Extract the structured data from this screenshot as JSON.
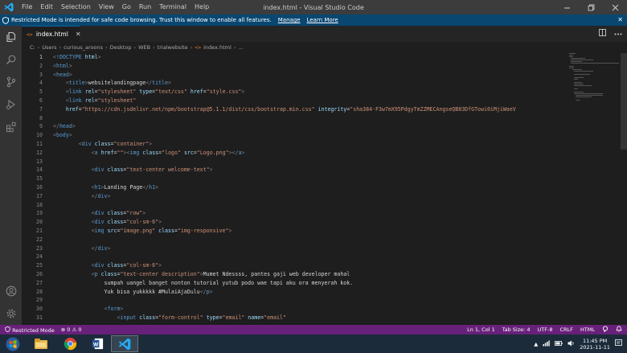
{
  "titlebar": {
    "menu": [
      "File",
      "Edit",
      "Selection",
      "View",
      "Go",
      "Run",
      "Terminal",
      "Help"
    ],
    "title": "index.html - Visual Studio Code",
    "controls": {
      "minimize": "🗕",
      "restore": "🗗",
      "close": "✕"
    }
  },
  "banner": {
    "message": "Restricted Mode is intended for safe code browsing. Trust this window to enable all features.",
    "manage": "Manage",
    "learn_more": "Learn More",
    "close": "✕"
  },
  "tab": {
    "icon": "<>",
    "label": "index.html",
    "close": "✕"
  },
  "breadcrumb": [
    "C:",
    "Users",
    "curious_aroons",
    "Desktop",
    "WEB",
    "trialwebsite",
    "index.html",
    "..."
  ],
  "code": {
    "lines": [
      [
        [
          "#808080",
          "<"
        ],
        [
          "#569cd6",
          "!DOCTYPE"
        ],
        [
          "#d4d4d4",
          " "
        ],
        [
          "#9cdcfe",
          "html"
        ],
        [
          "#808080",
          ">"
        ]
      ],
      [
        [
          "#808080",
          "<"
        ],
        [
          "#569cd6",
          "html"
        ],
        [
          "#808080",
          ">"
        ]
      ],
      [
        [
          "#808080",
          "<"
        ],
        [
          "#569cd6",
          "head"
        ],
        [
          "#808080",
          ">"
        ]
      ],
      [
        [
          "#d4d4d4",
          "    "
        ],
        [
          "#808080",
          "<"
        ],
        [
          "#569cd6",
          "title"
        ],
        [
          "#808080",
          ">"
        ],
        [
          "#d4d4d4",
          "websitelandingpage"
        ],
        [
          "#808080",
          "</"
        ],
        [
          "#569cd6",
          "title"
        ],
        [
          "#808080",
          ">"
        ]
      ],
      [
        [
          "#d4d4d4",
          "    "
        ],
        [
          "#808080",
          "<"
        ],
        [
          "#569cd6",
          "link"
        ],
        [
          "#d4d4d4",
          " "
        ],
        [
          "#9cdcfe",
          "rel"
        ],
        [
          "#d4d4d4",
          "="
        ],
        [
          "#ce9178",
          "\"stylesheet\""
        ],
        [
          "#d4d4d4",
          " "
        ],
        [
          "#9cdcfe",
          "type"
        ],
        [
          "#d4d4d4",
          "="
        ],
        [
          "#ce9178",
          "\"text/css\""
        ],
        [
          "#d4d4d4",
          " "
        ],
        [
          "#9cdcfe",
          "href"
        ],
        [
          "#d4d4d4",
          "="
        ],
        [
          "#ce9178",
          "\"style.css\""
        ],
        [
          "#808080",
          ">"
        ]
      ],
      [
        [
          "#d4d4d4",
          "    "
        ],
        [
          "#808080",
          "<"
        ],
        [
          "#569cd6",
          "link"
        ],
        [
          "#d4d4d4",
          " "
        ],
        [
          "#9cdcfe",
          "rel"
        ],
        [
          "#d4d4d4",
          "="
        ],
        [
          "#ce9178",
          "\"stylesheet\""
        ]
      ],
      [
        [
          "#d4d4d4",
          "    "
        ],
        [
          "#9cdcfe",
          "href"
        ],
        [
          "#d4d4d4",
          "="
        ],
        [
          "#ce9178",
          "\"https://cdn.jsdelivr.net/npm/bootstrap@5.1.1/dist/css/bootstrap.min.css\""
        ],
        [
          "#d4d4d4",
          " "
        ],
        [
          "#9cdcfe",
          "integrity"
        ],
        [
          "#d4d4d4",
          "="
        ],
        [
          "#ce9178",
          "\"sha384-F3w7mX95PdgyTmZZMECAngseQB83DfGTowi0iMjiWaeV"
        ]
      ],
      [
        [
          "#d4d4d4",
          ""
        ]
      ],
      [
        [
          "#808080",
          "</"
        ],
        [
          "#569cd6",
          "head"
        ],
        [
          "#808080",
          ">"
        ]
      ],
      [
        [
          "#808080",
          "<"
        ],
        [
          "#569cd6",
          "body"
        ],
        [
          "#808080",
          ">"
        ]
      ],
      [
        [
          "#d4d4d4",
          "        "
        ],
        [
          "#808080",
          "<"
        ],
        [
          "#569cd6",
          "div"
        ],
        [
          "#d4d4d4",
          " "
        ],
        [
          "#9cdcfe",
          "class"
        ],
        [
          "#d4d4d4",
          "="
        ],
        [
          "#ce9178",
          "\"container\""
        ],
        [
          "#808080",
          ">"
        ]
      ],
      [
        [
          "#d4d4d4",
          "            "
        ],
        [
          "#808080",
          "<"
        ],
        [
          "#569cd6",
          "a"
        ],
        [
          "#d4d4d4",
          " "
        ],
        [
          "#9cdcfe",
          "href"
        ],
        [
          "#d4d4d4",
          "="
        ],
        [
          "#ce9178",
          "\"\""
        ],
        [
          "#808080",
          "><"
        ],
        [
          "#569cd6",
          "img"
        ],
        [
          "#d4d4d4",
          " "
        ],
        [
          "#9cdcfe",
          "class"
        ],
        [
          "#d4d4d4",
          "="
        ],
        [
          "#ce9178",
          "\"logo\""
        ],
        [
          "#d4d4d4",
          " "
        ],
        [
          "#9cdcfe",
          "src"
        ],
        [
          "#d4d4d4",
          "="
        ],
        [
          "#ce9178",
          "\"Logo.png\""
        ],
        [
          "#808080",
          "></"
        ],
        [
          "#569cd6",
          "a"
        ],
        [
          "#808080",
          ">"
        ]
      ],
      [
        [
          "#d4d4d4",
          ""
        ]
      ],
      [
        [
          "#d4d4d4",
          "            "
        ],
        [
          "#808080",
          "<"
        ],
        [
          "#569cd6",
          "div"
        ],
        [
          "#d4d4d4",
          " "
        ],
        [
          "#9cdcfe",
          "class"
        ],
        [
          "#d4d4d4",
          "="
        ],
        [
          "#ce9178",
          "\"text-center welcome-text\""
        ],
        [
          "#808080",
          ">"
        ]
      ],
      [
        [
          "#d4d4d4",
          ""
        ]
      ],
      [
        [
          "#d4d4d4",
          "            "
        ],
        [
          "#808080",
          "<"
        ],
        [
          "#569cd6",
          "h1"
        ],
        [
          "#808080",
          ">"
        ],
        [
          "#d4d4d4",
          "Landing Page"
        ],
        [
          "#808080",
          "</"
        ],
        [
          "#569cd6",
          "h1"
        ],
        [
          "#808080",
          ">"
        ]
      ],
      [
        [
          "#d4d4d4",
          "            "
        ],
        [
          "#808080",
          "</"
        ],
        [
          "#569cd6",
          "div"
        ],
        [
          "#808080",
          ">"
        ]
      ],
      [
        [
          "#d4d4d4",
          ""
        ]
      ],
      [
        [
          "#d4d4d4",
          "            "
        ],
        [
          "#808080",
          "<"
        ],
        [
          "#569cd6",
          "div"
        ],
        [
          "#d4d4d4",
          " "
        ],
        [
          "#9cdcfe",
          "class"
        ],
        [
          "#d4d4d4",
          "="
        ],
        [
          "#ce9178",
          "\"row\""
        ],
        [
          "#808080",
          ">"
        ]
      ],
      [
        [
          "#d4d4d4",
          "            "
        ],
        [
          "#808080",
          "<"
        ],
        [
          "#569cd6",
          "div"
        ],
        [
          "#d4d4d4",
          " "
        ],
        [
          "#9cdcfe",
          "class"
        ],
        [
          "#d4d4d4",
          "="
        ],
        [
          "#ce9178",
          "\"col-sm-6\""
        ],
        [
          "#808080",
          ">"
        ]
      ],
      [
        [
          "#d4d4d4",
          "            "
        ],
        [
          "#808080",
          "<"
        ],
        [
          "#569cd6",
          "img"
        ],
        [
          "#d4d4d4",
          " "
        ],
        [
          "#9cdcfe",
          "src"
        ],
        [
          "#d4d4d4",
          "="
        ],
        [
          "#ce9178",
          "\"image.png\""
        ],
        [
          "#d4d4d4",
          " "
        ],
        [
          "#9cdcfe",
          "class"
        ],
        [
          "#d4d4d4",
          "="
        ],
        [
          "#ce9178",
          "\"img-responsive\""
        ],
        [
          "#808080",
          ">"
        ]
      ],
      [
        [
          "#d4d4d4",
          ""
        ]
      ],
      [
        [
          "#d4d4d4",
          "            "
        ],
        [
          "#808080",
          "</"
        ],
        [
          "#569cd6",
          "div"
        ],
        [
          "#808080",
          ">"
        ]
      ],
      [
        [
          "#d4d4d4",
          ""
        ]
      ],
      [
        [
          "#d4d4d4",
          "            "
        ],
        [
          "#808080",
          "<"
        ],
        [
          "#569cd6",
          "div"
        ],
        [
          "#d4d4d4",
          " "
        ],
        [
          "#9cdcfe",
          "class"
        ],
        [
          "#d4d4d4",
          "="
        ],
        [
          "#ce9178",
          "\"col-sm-6\""
        ],
        [
          "#808080",
          ">"
        ]
      ],
      [
        [
          "#d4d4d4",
          "            "
        ],
        [
          "#808080",
          "<"
        ],
        [
          "#569cd6",
          "p"
        ],
        [
          "#d4d4d4",
          " "
        ],
        [
          "#9cdcfe",
          "class"
        ],
        [
          "#d4d4d4",
          "="
        ],
        [
          "#ce9178",
          "\"text-center description\""
        ],
        [
          "#808080",
          ">"
        ],
        [
          "#d4d4d4",
          "Mumet Ndessss, pantes gaji web developer mahal"
        ]
      ],
      [
        [
          "#d4d4d4",
          "                sumpah uangel banget nonton tutorial yutub podo wae tapi aku ora menyerah kok."
        ]
      ],
      [
        [
          "#d4d4d4",
          "                Yuk bisa yukkkkk #MulaiAjaDulu"
        ],
        [
          "#808080",
          "</"
        ],
        [
          "#569cd6",
          "p"
        ],
        [
          "#808080",
          ">"
        ]
      ],
      [
        [
          "#d4d4d4",
          ""
        ]
      ],
      [
        [
          "#d4d4d4",
          "                "
        ],
        [
          "#808080",
          "<"
        ],
        [
          "#569cd6",
          "form"
        ],
        [
          "#808080",
          ">"
        ]
      ],
      [
        [
          "#d4d4d4",
          "                    "
        ],
        [
          "#808080",
          "<"
        ],
        [
          "#569cd6",
          "input"
        ],
        [
          "#d4d4d4",
          " "
        ],
        [
          "#9cdcfe",
          "class"
        ],
        [
          "#d4d4d4",
          "="
        ],
        [
          "#ce9178",
          "\"form-control\""
        ],
        [
          "#d4d4d4",
          " "
        ],
        [
          "#9cdcfe",
          "type"
        ],
        [
          "#d4d4d4",
          "="
        ],
        [
          "#ce9178",
          "\"email\""
        ],
        [
          "#d4d4d4",
          " "
        ],
        [
          "#9cdcfe",
          "name"
        ],
        [
          "#d4d4d4",
          "="
        ],
        [
          "#ce9178",
          "\"email\""
        ]
      ]
    ]
  },
  "statusbar": {
    "restricted": "Restricted Mode",
    "errors": "0",
    "warnings": "0",
    "position": "Ln 1, Col 1",
    "tab_size": "Tab Size: 4",
    "encoding": "UTF-8",
    "eol": "CRLF",
    "language": "HTML"
  },
  "taskbar": {
    "time": "11:45 PM",
    "date": "2021-11-11"
  },
  "colors": {
    "accent": "#0e639c",
    "statusbar": "#68217a",
    "banner": "#094771"
  }
}
